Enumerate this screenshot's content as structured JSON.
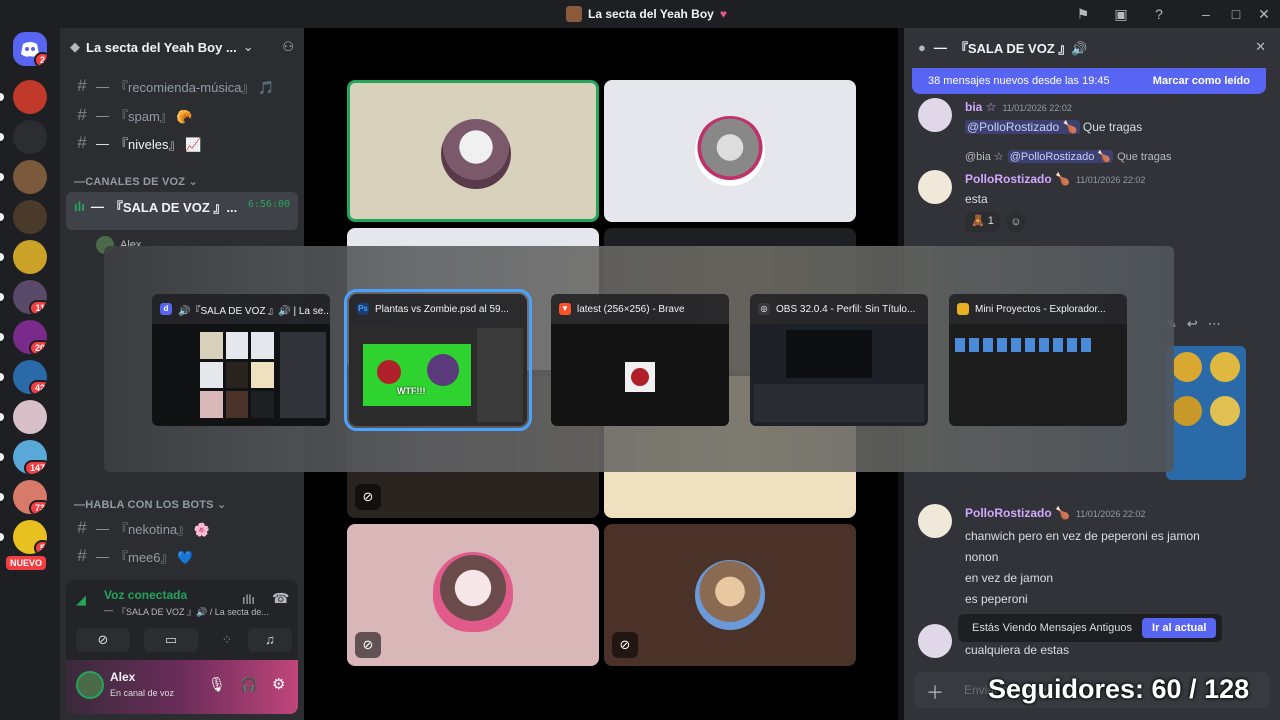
{
  "window": {
    "title": "La secta del Yeah Boy"
  },
  "rail": {
    "home_badge": "2",
    "servers": [
      {
        "name": "server-1",
        "color": "#c0392b",
        "badge": ""
      },
      {
        "name": "server-2",
        "color": "#2b2d31",
        "badge": ""
      },
      {
        "name": "server-3",
        "color": "#7a5a3a",
        "badge": ""
      },
      {
        "name": "server-4",
        "color": "#4a3a2a",
        "badge": ""
      },
      {
        "name": "server-5",
        "color": "#c9a227",
        "badge": ""
      },
      {
        "name": "server-6",
        "color": "#5a4a6a",
        "badge": "11"
      },
      {
        "name": "server-7",
        "color": "#7a2a8a",
        "badge": "20"
      },
      {
        "name": "server-8",
        "color": "#2a6aa8",
        "badge": "42"
      },
      {
        "name": "server-9",
        "color": "#d8c0c8",
        "badge": ""
      },
      {
        "name": "server-10",
        "color": "#5aa8d8",
        "badge": "147"
      },
      {
        "name": "server-11",
        "color": "#d87a6a",
        "badge": "73"
      },
      {
        "name": "server-12",
        "color": "#e8c020",
        "badge": "5"
      }
    ],
    "new_label": "NUEVO"
  },
  "sidebar": {
    "server_name": "La secta del Yeah Boy ...",
    "channels_top": [
      {
        "name": "『recomienda-música』 🎵"
      },
      {
        "name": "『spam』 🥐"
      },
      {
        "name": "『niveles』 📈"
      }
    ],
    "voice_category": "CANALES DE VOZ",
    "voice_channel": "『SALA DE VOZ 』...",
    "voice_timer": "6:56:00",
    "voice_user": "Alex",
    "bots_category": "HABLA CON LOS BOTS",
    "channels_bots": [
      {
        "name": "『nekotina』 🌸"
      },
      {
        "name": "『mee6』 💙"
      }
    ],
    "voice_connected": "Voz conectada",
    "voice_connected_sub": "『SALA DE VOZ 』🔊 / La secta de...",
    "user_name": "Alex",
    "user_status": "En canal de voz"
  },
  "chat": {
    "header": "『SALA DE VOZ 』🔊",
    "new_messages": "38 mensajes nuevos desde las 19:45",
    "mark_read": "Marcar como leído",
    "messages": [
      {
        "author": "bia ☆",
        "time": "11/01/2026 22:02",
        "mention": "@PolloRostizado 🍗",
        "text": "Que tragas"
      },
      {
        "reply_author": "@bia ☆",
        "reply_mention": "@PolloRostizado 🍗",
        "reply_text": "Que tragas",
        "author": "PolloRostizado 🍗",
        "time": "11/01/2026 22:02",
        "text": "esta",
        "reaction_count": "1"
      },
      {
        "author": "PolloRostizado 🍗",
        "time": "11/01/2026 22:02",
        "lines": [
          "chanwich pero en vez de peperoni es jamon",
          "nonon",
          "en vez de jamon",
          "es peperoni"
        ]
      },
      {
        "text": "cualquiera de estas"
      }
    ],
    "old_messages": "Estás Viendo Mensajes Antiguos",
    "jump": "Ir al actual",
    "input_placeholder": "Enviar mensaje"
  },
  "switcher": {
    "windows": [
      {
        "title": "🔊『SALA DE VOZ 』🔊 | La se...",
        "app": "discord",
        "color": "#5865f2"
      },
      {
        "title": "Plantas vs Zombie.psd al 59...",
        "app": "photoshop",
        "color": "#1f3a6e"
      },
      {
        "title": "latest (256×256) - Brave",
        "app": "brave",
        "color": "#fb542b"
      },
      {
        "title": "OBS 32.0.4 - Perfil: Sin Título...",
        "app": "obs",
        "color": "#3a3a3a"
      },
      {
        "title": "Mini Proyectos - Explorador...",
        "app": "explorer",
        "color": "#e8b020"
      }
    ],
    "psd_caption": "WTF!!!"
  },
  "overlay": {
    "followers": "Seguidores: 60 / 128"
  }
}
